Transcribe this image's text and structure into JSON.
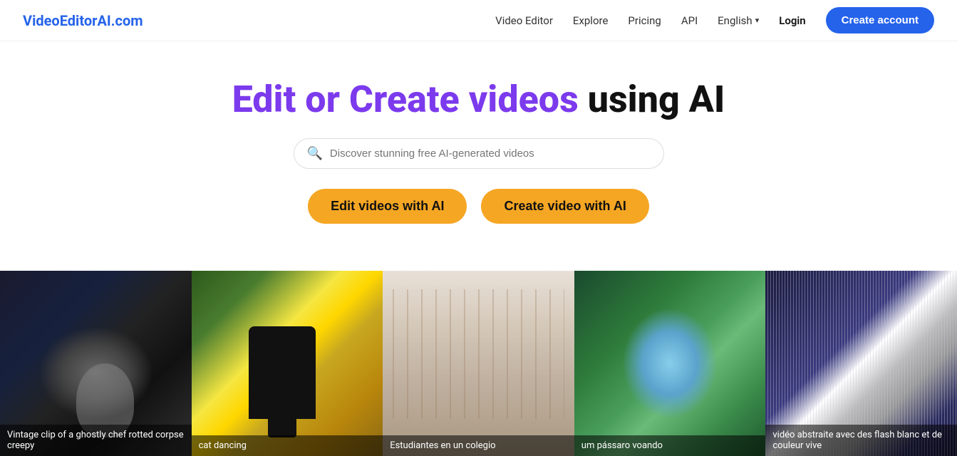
{
  "brand": {
    "name": "VideoEditorAI.com",
    "url": "#"
  },
  "nav": {
    "links": [
      {
        "id": "video-editor",
        "label": "Video Editor"
      },
      {
        "id": "explore",
        "label": "Explore"
      },
      {
        "id": "pricing",
        "label": "Pricing"
      },
      {
        "id": "api",
        "label": "API"
      }
    ],
    "language": "English",
    "login_label": "Login",
    "cta_label": "Create account"
  },
  "hero": {
    "title_part1": "Edit or Create videos",
    "title_part2": "using AI",
    "search_placeholder": "Discover stunning free AI-generated videos",
    "btn_edit": "Edit videos with AI",
    "btn_create": "Create video with AI"
  },
  "videos": [
    {
      "id": "v1",
      "label": "Vintage clip of a ghostly chef rotted corpse creepy"
    },
    {
      "id": "v2",
      "label": "cat dancing"
    },
    {
      "id": "v3",
      "label": "Estudiantes en un colegio"
    },
    {
      "id": "v4",
      "label": "um pássaro voando"
    },
    {
      "id": "v5",
      "label": "vidéo abstraite avec des flash blanc et de couleur vive"
    }
  ]
}
